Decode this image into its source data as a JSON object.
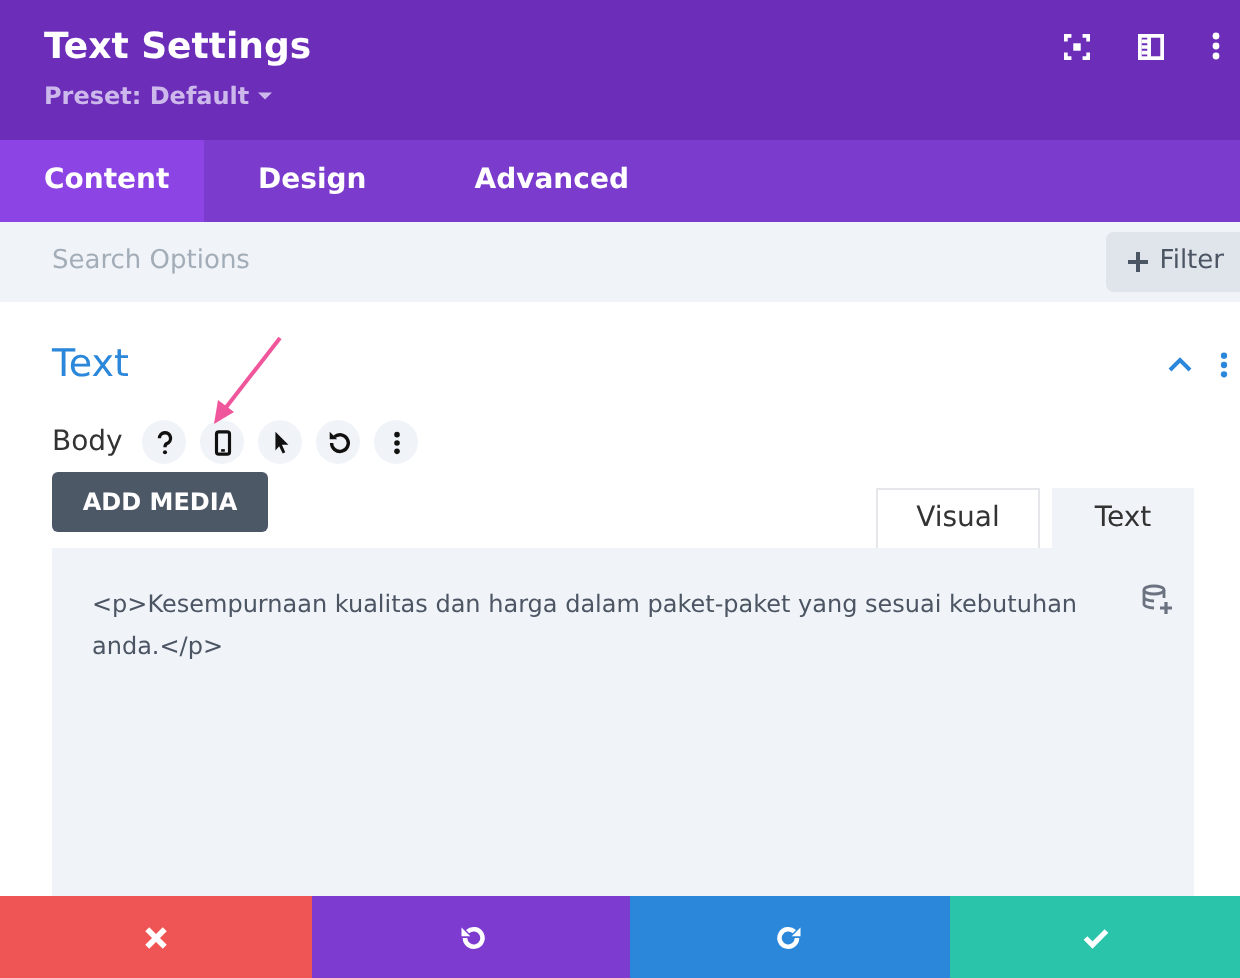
{
  "header": {
    "title": "Text Settings",
    "preset": "Preset: Default"
  },
  "tabs": [
    {
      "label": "Content",
      "selected": true
    },
    {
      "label": "Design",
      "selected": false
    },
    {
      "label": "Advanced",
      "selected": false
    }
  ],
  "search": {
    "placeholder": "Search Options",
    "filter": "Filter"
  },
  "section": {
    "title": "Text",
    "expanded": true,
    "field_label": "Body",
    "add_media": "ADD MEDIA",
    "editor_tabs": [
      {
        "label": "Visual",
        "selected": false
      },
      {
        "label": "Text",
        "selected": true
      }
    ],
    "content": "<p>Kesempurnaan kualitas dan harga dalam paket-paket yang sesuai kebutuhan anda.</p>"
  },
  "footer": [
    {
      "kind": "cancel"
    },
    {
      "kind": "undo"
    },
    {
      "kind": "redo"
    },
    {
      "kind": "save"
    }
  ]
}
